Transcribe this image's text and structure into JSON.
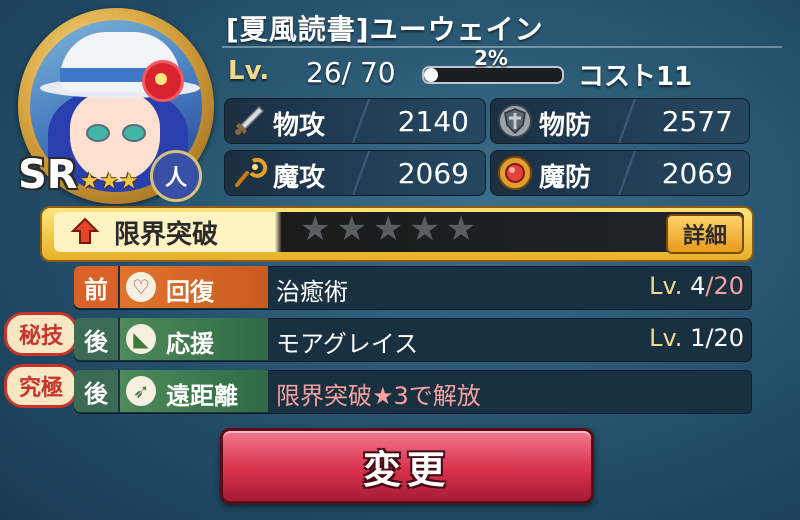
{
  "unit": {
    "name": "[夏風読書]ユーウェイン",
    "rarity": "SR",
    "rarity_stars": "★★★",
    "type_badge": "人",
    "level_label": "Lv.",
    "level_value": "26/ 70",
    "exp_percent_text": "2%",
    "exp_fraction": 0.02,
    "cost_text": "コスト11"
  },
  "stats": [
    {
      "label": "物攻",
      "value": "2140",
      "icon": "sword-icon"
    },
    {
      "label": "物防",
      "value": "2577",
      "icon": "shield-icon"
    },
    {
      "label": "魔攻",
      "value": "2069",
      "icon": "staff-icon"
    },
    {
      "label": "魔防",
      "value": "2069",
      "icon": "orb-icon"
    }
  ],
  "limit_break": {
    "label": "限界突破",
    "stars": "★★★★★",
    "filled": 0,
    "total": 5,
    "detail_label": "詳細"
  },
  "skills": [
    {
      "badge": "",
      "position": "前",
      "category": "回復",
      "category_icon": "heart-icon",
      "name": "治癒術",
      "lv_label": "Lv.",
      "lv_current": "4",
      "lv_sep": "/",
      "lv_max": "20"
    },
    {
      "badge": "秘技",
      "position": "後",
      "category": "応援",
      "category_icon": "megaphone-icon",
      "name": "モアグレイス",
      "lv_label": "Lv.",
      "lv_current": "1",
      "lv_sep": "/",
      "lv_max": "20"
    },
    {
      "badge": "究極",
      "position": "後",
      "category": "遠距離",
      "category_icon": "bow-icon",
      "name": "限界突破★3で解放",
      "lv_label": "",
      "lv_current": "",
      "lv_sep": "",
      "lv_max": ""
    }
  ],
  "change_button": "変更",
  "colors": {
    "accent_gold": "#f3d98a",
    "button_red": "#d8314d",
    "position_front": "#d9622b",
    "position_back": "#3b6b52",
    "locked_text": "#f7a1a1"
  }
}
